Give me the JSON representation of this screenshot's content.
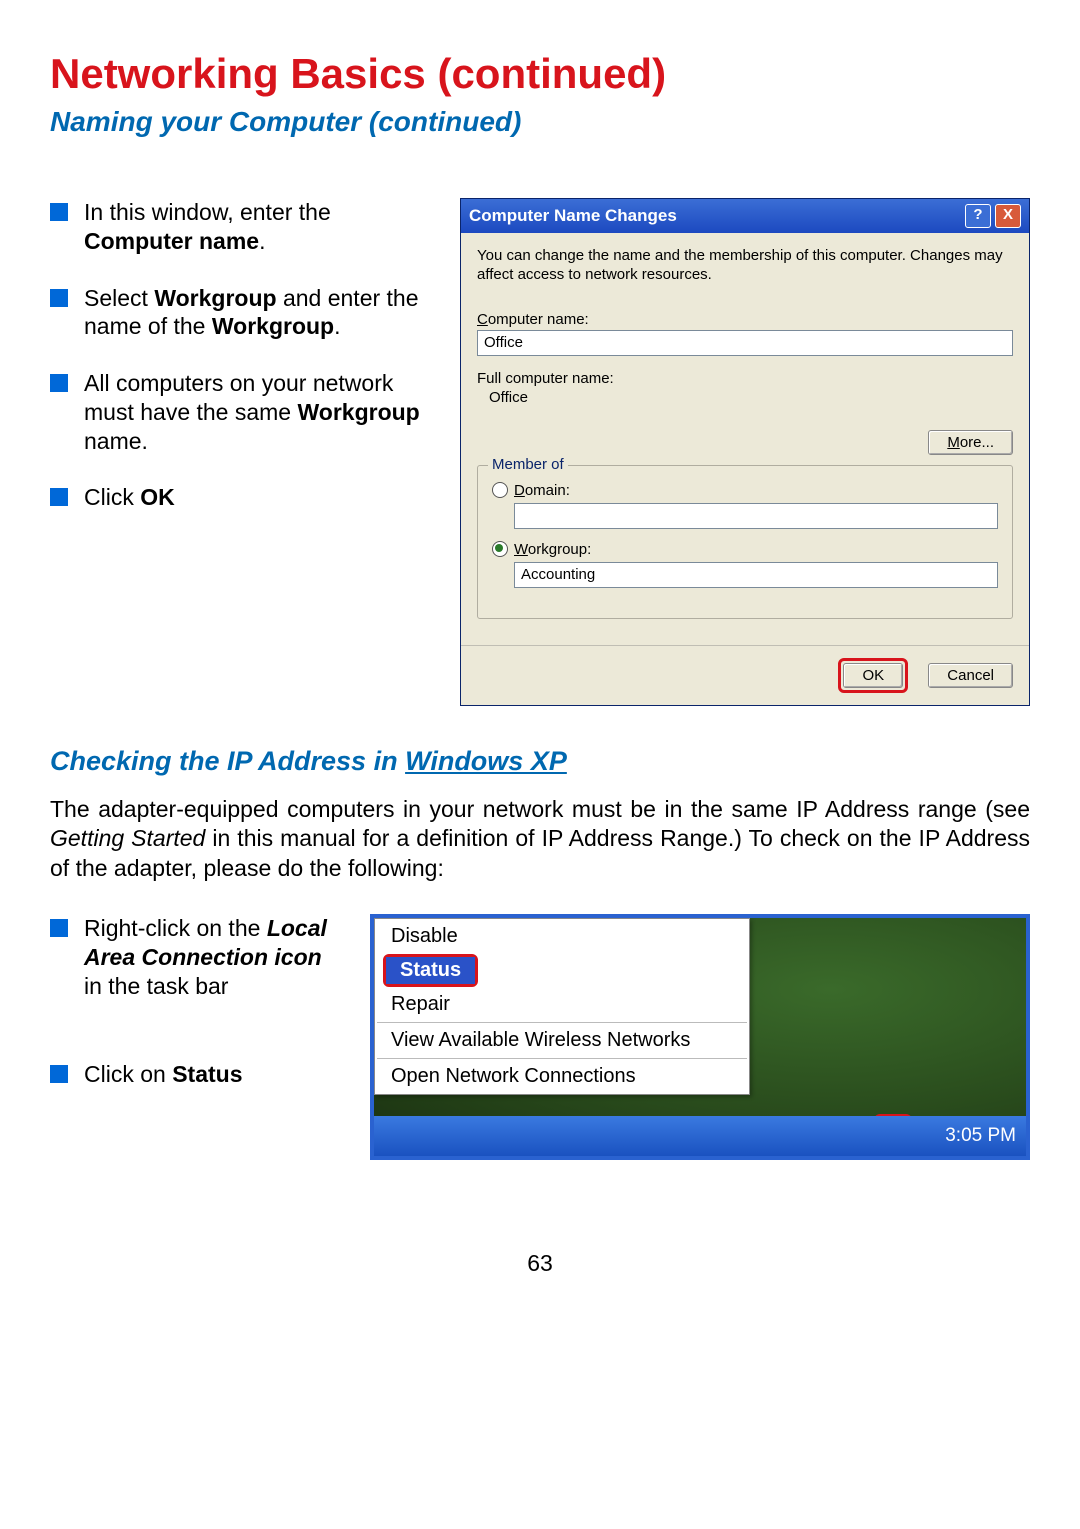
{
  "page": {
    "title": "Networking Basics (continued)",
    "subtitle": "Naming your Computer (continued)",
    "number": "63"
  },
  "instructions1": {
    "i1_a": "In this window, enter the ",
    "i1_b": "Computer name",
    "i1_c": ".",
    "i2_a": "Select ",
    "i2_b": "Workgroup",
    "i2_c": " and enter the name of the ",
    "i2_d": "Workgroup",
    "i2_e": ".",
    "i3_a": "All computers on your network must have the same ",
    "i3_b": "Workgroup",
    "i3_c": " name.",
    "i4_a": "Click ",
    "i4_b": "OK"
  },
  "dialog1": {
    "title": "Computer Name Changes",
    "help": "?",
    "close": "X",
    "desc": "You can change the name and the membership of this computer. Changes may affect access to network resources.",
    "cn_label": "Computer name:",
    "cn_value": "Office",
    "fcn_label": "Full computer name:",
    "fcn_value": "Office",
    "more": "More...",
    "group": "Member of",
    "domain": "Domain:",
    "workgroup": "Workgroup:",
    "workgroup_value": "Accounting",
    "ok": "OK",
    "cancel": "Cancel"
  },
  "section2": {
    "title_a": "Checking the IP Address in ",
    "title_b": "Windows XP",
    "para_a": "The adapter-equipped computers in your network must be in the same IP Address range (see ",
    "para_b": "Getting Started",
    "para_c": " in this manual for a definition of IP Address Range.)  To check on the IP Address of the adapter, please do the following:"
  },
  "instructions2": {
    "i1_a": "Right-click on the ",
    "i1_b": "Local Area Connection icon",
    "i1_c": " in the task bar",
    "i2_a": "Click on ",
    "i2_b": "Status"
  },
  "menu": {
    "disable": "Disable",
    "status": "Status",
    "repair": "Repair",
    "view": "View Available Wireless Networks",
    "open": "Open Network Connections"
  },
  "taskbar": {
    "time": "3:05 PM"
  }
}
